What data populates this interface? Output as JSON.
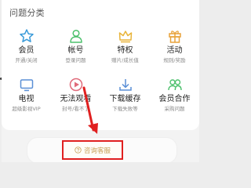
{
  "section_title": "问题分类",
  "categories": [
    {
      "label": "会员",
      "sub": "开通/关闭",
      "icon": "star-icon",
      "color": "#3a9bd9"
    },
    {
      "label": "帐号",
      "sub": "登录问题",
      "icon": "user-icon",
      "color": "#4cc06c"
    },
    {
      "label": "特权",
      "sub": "赠片/成长值",
      "icon": "crown-icon",
      "color": "#e8b43a"
    },
    {
      "label": "活动",
      "sub": "规则/奖励",
      "icon": "gift-icon",
      "color": "#e8a23a"
    },
    {
      "label": "电视",
      "sub": "超级影视VIP",
      "icon": "tv-icon",
      "color": "#5a8fd6"
    },
    {
      "label": "无法观看",
      "sub": "封号/看不了",
      "icon": "video-blocked-icon",
      "color": "#e06a7a"
    },
    {
      "label": "下载缓存",
      "sub": "下载失败等",
      "icon": "download-icon",
      "color": "#5a8fd6"
    },
    {
      "label": "会员合作",
      "sub": "采购问题",
      "icon": "cooperation-icon",
      "color": "#4cc06c"
    }
  ],
  "consult_button": {
    "label": "咨询客服",
    "icon": "question-circle-icon",
    "highlight_color": "#e02020"
  }
}
